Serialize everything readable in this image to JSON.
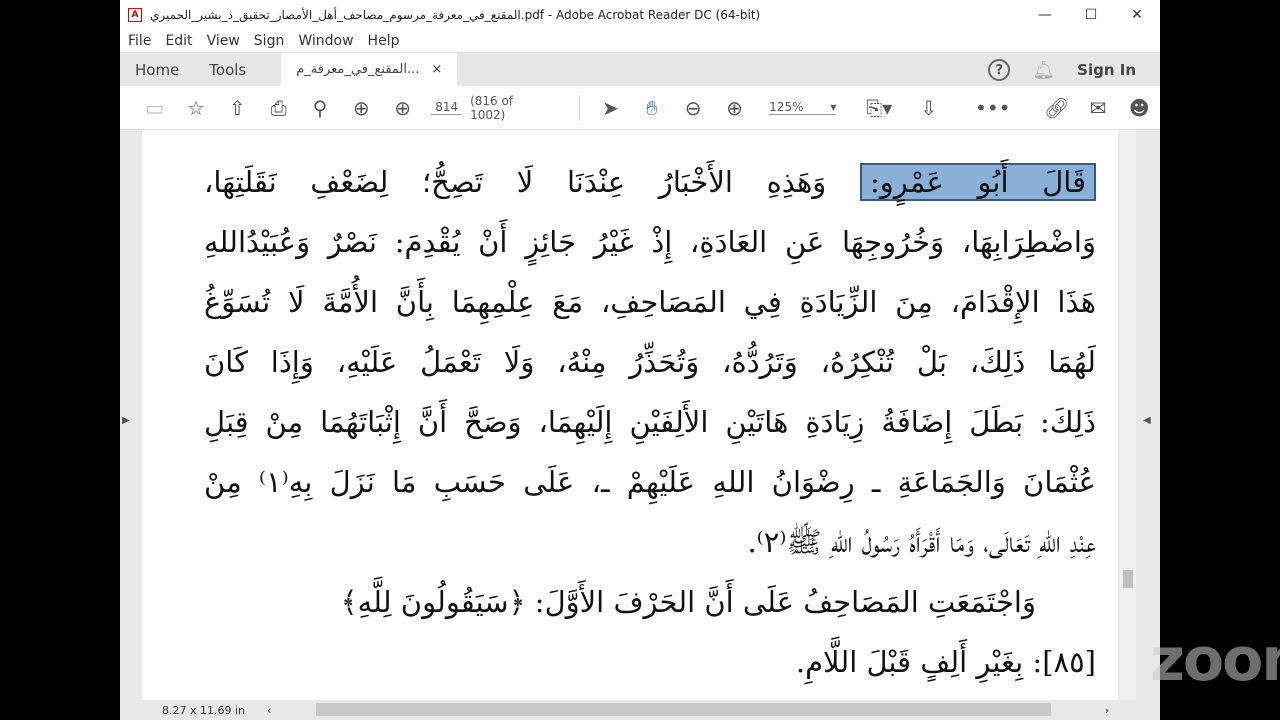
{
  "window": {
    "title": "المقنع_في_معرفة_مرسوم_مصاحف_أهل_الأمصار_تحقيق_د_بشير_الحميري.pdf - Adobe Acrobat Reader DC (64-bit)",
    "controls": [
      "—",
      "☐",
      "✕"
    ]
  },
  "menu": [
    "File",
    "Edit",
    "View",
    "Sign",
    "Window",
    "Help"
  ],
  "tabs": {
    "home": "Home",
    "tools": "Tools",
    "doc": "المقنع_في_معرفة_م...",
    "close": "×",
    "sign_in": "Sign In"
  },
  "toolbar": {
    "page_input": "814",
    "page_of": "(816 of 1002)",
    "zoom": "125%"
  },
  "document": {
    "lines": [
      "قَالَ أَبُو عَمْرٍو:",
      "وَهَذِهِ الأَخْبَارُ عِنْدَنَا لَا تَصِحُّ؛ لِضَعْفِ نَقَلَتِهَا،",
      "وَاضْطِرَابِهَا، وَخُرُوجِهَا عَنِ العَادَةِ، إِذْ غَيْرُ جَائِزٍ أَنْ يُقْدِمَ: نَصْرٌ وَعُبَيْدُاللهِ",
      "هَذَا الإِقْدَامَ، مِنَ الزِّيَادَةِ فِي المَصَاحِفِ، مَعَ عِلْمِهِمَا بِأَنَّ الأُمَّةَ لَا تُسَوِّغُ",
      "لَهُمَا ذَلِكَ، بَلْ تُنْكِرُهُ، وَتَرُدُّهُ، وَتُحَذِّرُ مِنْهُ، وَلَا تَعْمَلُ عَلَيْهِ، وَإِذَا كَانَ",
      "ذَلِكَ: بَطَلَ إِضَافَةُ زِيَادَةِ هَاتَيْنِ الأَلِفَيْنِ إِلَيْهِمَا، وَصَحَّ أَنَّ إِثْبَاتَهُمَا مِنْ قِبَلِ",
      "عُثْمَانَ وَالجَمَاعَةِ ـ رِضْوَانُ اللهِ عَلَيْهِمْ ـ، عَلَى حَسَبِ مَا نَزَلَ بِهِ⁽١⁾ مِنْ",
      "عِنْدِ اللهِ تَعَالَى، وَمَا أَقْرَأَهُ رَسُولُ اللهِ ﷺ⁽٢⁾.",
      "وَاجْتَمَعَتِ المَصَاحِفُ عَلَى أَنَّ الحَرْفَ الأَوَّلَ: ﴿سَيَقُولُونَ لِلَّهِ﴾",
      "[٨٥]: بِغَيْرِ أَلِفٍ قَبْلَ اللَّامِ."
    ]
  },
  "status": {
    "page_size": "8.27 x 11.69 in"
  },
  "watermark": "zoom"
}
